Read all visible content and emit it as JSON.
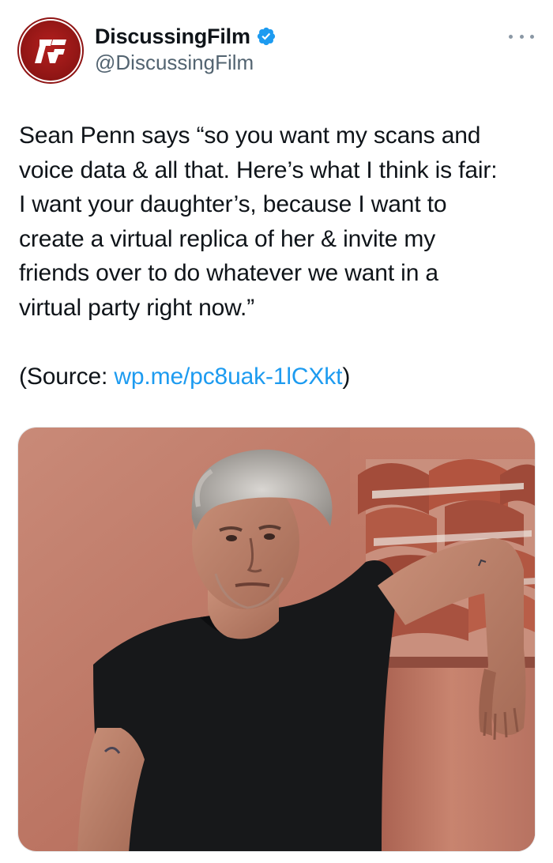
{
  "author": {
    "display_name": "DiscussingFilm",
    "handle": "@DiscussingFilm",
    "avatar_icon": "discussingfilm-logo-icon",
    "verified_icon": "verified-badge-icon",
    "avatar_color": "#9e1818",
    "verified_color": "#1d9bf0"
  },
  "menu": {
    "icon": "more-options-icon"
  },
  "tweet": {
    "lines": [
      "Sean Penn says “so you want my scans and",
      "voice data & all that. Here’s what I think is fair:",
      "I want your daughter’s, because I want to",
      "create a virtual replica of her & invite my",
      "friends over to do whatever we want in a",
      "virtual party right now.”"
    ],
    "source_prefix": "(Source: ",
    "source_link": "wp.me/pc8uak-1lCXkt",
    "source_suffix": ")",
    "link_color": "#1d9bf0"
  },
  "media": {
    "kind": "photo",
    "subject": "man-in-black-tshirt-leaning-on-terracotta-wall"
  }
}
